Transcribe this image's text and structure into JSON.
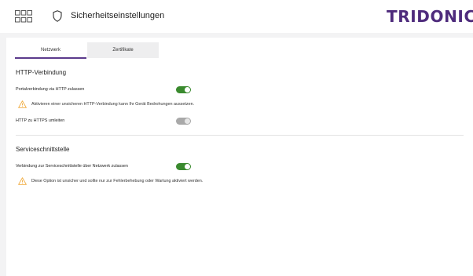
{
  "header": {
    "title": "Sicherheitseinstellungen",
    "logo": "TRIDONIC",
    "brand_color": "#4e2b7c"
  },
  "tabs": [
    {
      "label": "Netzwerk",
      "active": true
    },
    {
      "label": "Zertifikate",
      "active": false
    }
  ],
  "http_section": {
    "title": "HTTP-Verbindung",
    "allow_http": {
      "label": "Portalverbindung via HTTP zulassen",
      "enabled": true,
      "warning": "Aktivieren einer unsicheren HTTP-Verbindung kann Ihr Gerät Bedrohungen aussetzen."
    },
    "redirect": {
      "label": "HTTP zu HTTPS umleiten",
      "enabled": false
    }
  },
  "service_section": {
    "title": "Serviceschnittstelle",
    "allow_service": {
      "label": "Verbindung zur Serviceschnittstelle über Netzwerk zulassen",
      "enabled": true,
      "warning": "Diese Option ist unsicher und sollte nur zur Fehlerbehebung oder Wartung aktiviert werden."
    }
  },
  "colors": {
    "toggle_on": "#3a8a2e",
    "toggle_disabled": "#a9a9a9",
    "warning": "#f0a93a",
    "tab_indicator": "#5b3a8c"
  },
  "icons": [
    "apps-grid-icon",
    "shield-icon",
    "warning-icon"
  ]
}
